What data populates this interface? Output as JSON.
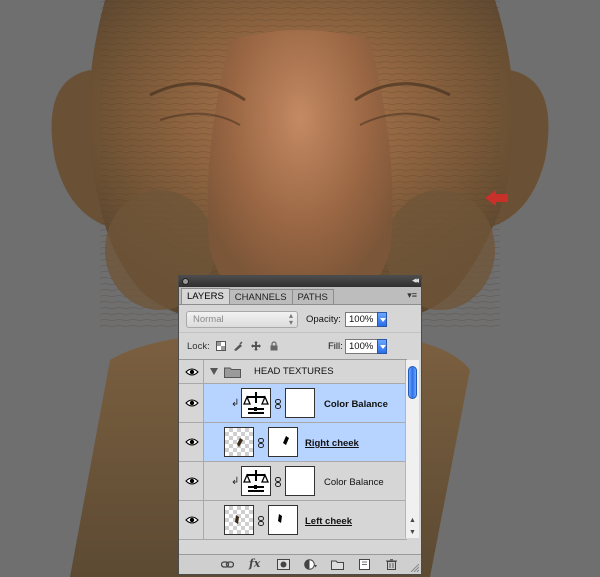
{
  "canvas": {
    "background_color": "#6f6f6f",
    "annotation_arrow_color": "#c8302a"
  },
  "panel": {
    "tabs": [
      {
        "label": "LAYERS",
        "active": true
      },
      {
        "label": "CHANNELS",
        "active": false
      },
      {
        "label": "PATHS",
        "active": false
      }
    ],
    "blend_mode": "Normal",
    "opacity_label": "Opacity:",
    "opacity_value": "100%",
    "lock_label": "Lock:",
    "fill_label": "Fill:",
    "fill_value": "100%",
    "layers": {
      "group": {
        "name": "HEAD TEXTURES",
        "icon": "folder-icon"
      },
      "items": [
        {
          "name": "Color Balance",
          "type": "adjustment",
          "selected": true,
          "clipped": true
        },
        {
          "name": "Right cheek",
          "type": "pixel",
          "selected": true,
          "clipped": false
        },
        {
          "name": "Color Balance",
          "type": "adjustment",
          "selected": false,
          "clipped": true
        },
        {
          "name": "Left cheek",
          "type": "pixel",
          "selected": false,
          "clipped": false
        }
      ]
    },
    "bottom_icons": [
      "link-layers-icon",
      "fx-icon",
      "add-mask-icon",
      "new-adjustment-icon",
      "new-group-icon",
      "new-layer-icon",
      "trash-icon"
    ],
    "fx_label": "fx",
    "selection_color": "#b7d3ff",
    "accent_color": "#2c6ee8"
  }
}
